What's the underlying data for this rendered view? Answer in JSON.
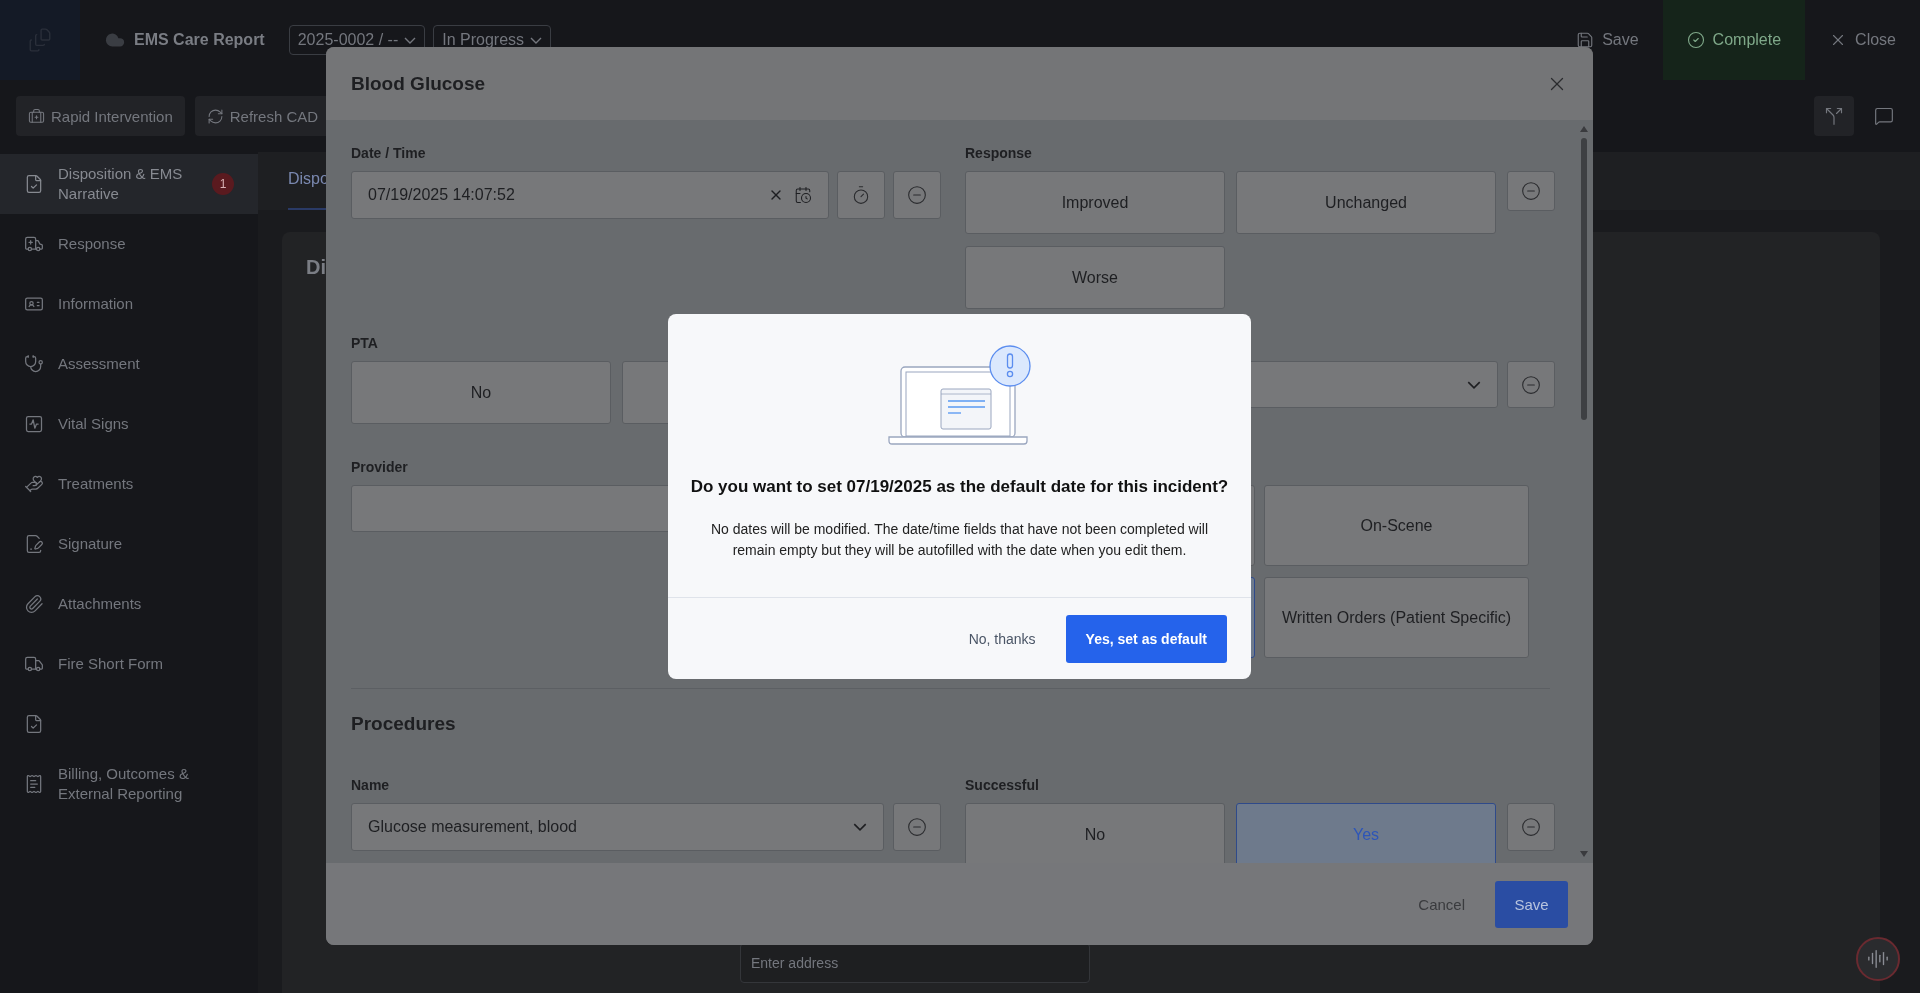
{
  "app_bar": {
    "title": "EMS Care Report",
    "incident": "2025-0002 / --",
    "status": "In Progress",
    "actions": [
      {
        "label": "Save",
        "kind": "plain"
      },
      {
        "label": "Complete",
        "kind": "success"
      },
      {
        "label": "Close",
        "kind": "plain"
      }
    ]
  },
  "toolbar": {
    "buttons": [
      "Rapid Intervention",
      "Refresh CAD"
    ]
  },
  "sidebar": {
    "items": [
      {
        "label": "Disposition & EMS Narrative",
        "selected": true,
        "badge": "1"
      },
      {
        "label": "Response",
        "selected": false
      },
      {
        "label": "Information",
        "selected": false
      },
      {
        "label": "Assessment",
        "selected": false
      },
      {
        "label": "Vital Signs",
        "selected": false
      },
      {
        "label": "Treatments",
        "selected": false
      },
      {
        "label": "Signature",
        "selected": false
      },
      {
        "label": "Attachments",
        "selected": false
      },
      {
        "label": "Fire Short Form",
        "selected": false
      },
      {
        "selected": false
      },
      {
        "label": "Billing, Outcomes & External Reporting",
        "selected": false
      }
    ]
  },
  "content": {
    "tab": "Dispo",
    "card_title": "Di",
    "address": {
      "placeholder": "Enter address"
    }
  },
  "modal": {
    "title": "Blood Glucose",
    "date_time": {
      "label": "Date / Time",
      "value": "07/19/2025 14:07:52"
    },
    "response": {
      "label": "Response",
      "options": [
        {
          "label": "Improved",
          "selected": false
        },
        {
          "label": "Unchanged",
          "selected": false
        },
        {
          "label": "Worse",
          "selected": false
        }
      ]
    },
    "pta": {
      "label": "PTA",
      "options": [
        {
          "label": "No",
          "selected": false
        },
        {
          "selected": false
        }
      ]
    },
    "provider": {
      "label": "Provider"
    },
    "authorization": {
      "options": [
        {
          "selected": false
        },
        {
          "label": "On-Scene",
          "selected": false
        },
        {
          "selected": true
        },
        {
          "label": "Written Orders (Patient Specific)",
          "selected": false
        }
      ]
    },
    "procedures": {
      "heading": "Procedures",
      "name": {
        "label": "Name",
        "value": "Glucose measurement, blood"
      },
      "successful": {
        "label": "Successful",
        "options": [
          {
            "label": "No",
            "selected": false
          },
          {
            "label": "Yes",
            "selected": true
          }
        ]
      }
    },
    "footer": {
      "cancel": "Cancel",
      "save": "Save"
    }
  },
  "dialog": {
    "heading": "Do you want to set 07/19/2025 as the default date for this incident?",
    "body": "No dates will be modified. The date/time fields that have not been completed will remain empty but they will be autofilled with the date when you edit them.",
    "decline": "No, thanks",
    "confirm": "Yes, set as default"
  }
}
